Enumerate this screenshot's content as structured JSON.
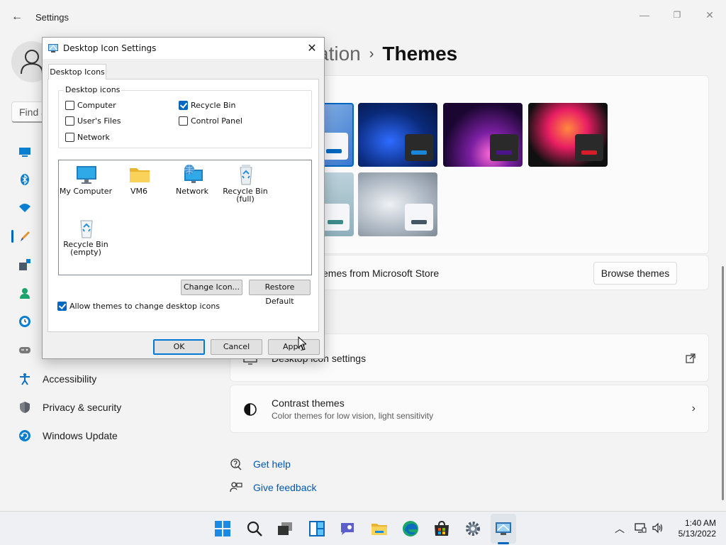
{
  "settings": {
    "app_title": "Settings",
    "back_glyph": "←",
    "window_controls": {
      "minimize": "—",
      "maximize": "❐",
      "close": "✕"
    },
    "search": {
      "placeholder": "Find a"
    },
    "breadcrumb": {
      "parent": "ation",
      "separator": "›",
      "current": "Themes"
    },
    "nav": {
      "selected": "personalization",
      "items": [
        {
          "label": "Accessibility",
          "icon": "accessibility-icon"
        },
        {
          "label": "Privacy & security",
          "icon": "shield-icon"
        },
        {
          "label": "Windows Update",
          "icon": "windows-update-icon"
        }
      ],
      "icon_only": [
        "system-icon",
        "bluetooth-icon",
        "network-icon",
        "personalization-icon",
        "apps-icon",
        "accounts-icon",
        "time-language-icon",
        "gaming-icon"
      ]
    },
    "store": {
      "text": "emes from Microsoft Store",
      "browse_label": "Browse themes"
    },
    "rows": [
      {
        "title": "Desktop icon settings",
        "icon": "desktop-icon",
        "trail": "external-link-icon"
      },
      {
        "title": "Contrast themes",
        "subtitle": "Color themes for low vision, light sensitivity",
        "icon": "contrast-icon",
        "trail": "›"
      }
    ],
    "links": [
      {
        "label": "Get help",
        "icon": "help-icon"
      },
      {
        "label": "Give feedback",
        "icon": "feedback-icon"
      }
    ],
    "theme_accents": [
      "#0067c0",
      "#1a86d9",
      "#4a148c",
      "#d81b28",
      "#3d8c8c",
      "#445566"
    ]
  },
  "dialog": {
    "title": "Desktop Icon Settings",
    "close_glyph": "✕",
    "tab_label": "Desktop Icons",
    "group_label": "Desktop icons",
    "checkboxes": [
      {
        "label": "Computer",
        "checked": false
      },
      {
        "label": "Recycle Bin",
        "checked": true
      },
      {
        "label": "User's Files",
        "checked": false
      },
      {
        "label": "Control Panel",
        "checked": false
      },
      {
        "label": "Network",
        "checked": false
      }
    ],
    "icons": [
      {
        "label": "My Computer",
        "icon": "monitor-icon"
      },
      {
        "label": "VM6",
        "icon": "folder-icon"
      },
      {
        "label": "Network",
        "icon": "network-globe-icon"
      },
      {
        "label": "Recycle Bin (full)",
        "line1": "Recycle Bin",
        "line2": "(full)",
        "icon": "recycle-bin-full-icon"
      },
      {
        "label": "Recycle Bin (empty)",
        "line1": "Recycle Bin",
        "line2": "(empty)",
        "icon": "recycle-bin-empty-icon"
      }
    ],
    "change_icon_label": "Change Icon...",
    "restore_default_label": "Restore Default",
    "allow_themes": {
      "label": "Allow themes to change desktop icons",
      "checked": true
    },
    "ok_label": "OK",
    "cancel_label": "Cancel",
    "apply_label": "Apply"
  },
  "taskbar": {
    "pinned": [
      "start-icon",
      "search-icon",
      "task-view-icon",
      "widgets-icon",
      "chat-icon",
      "file-explorer-icon",
      "edge-icon",
      "store-icon",
      "settings-icon",
      "desktop-icon-settings-app-icon"
    ],
    "tray": {
      "chevron": "︿"
    },
    "time": "1:40 AM",
    "date": "5/13/2022"
  }
}
